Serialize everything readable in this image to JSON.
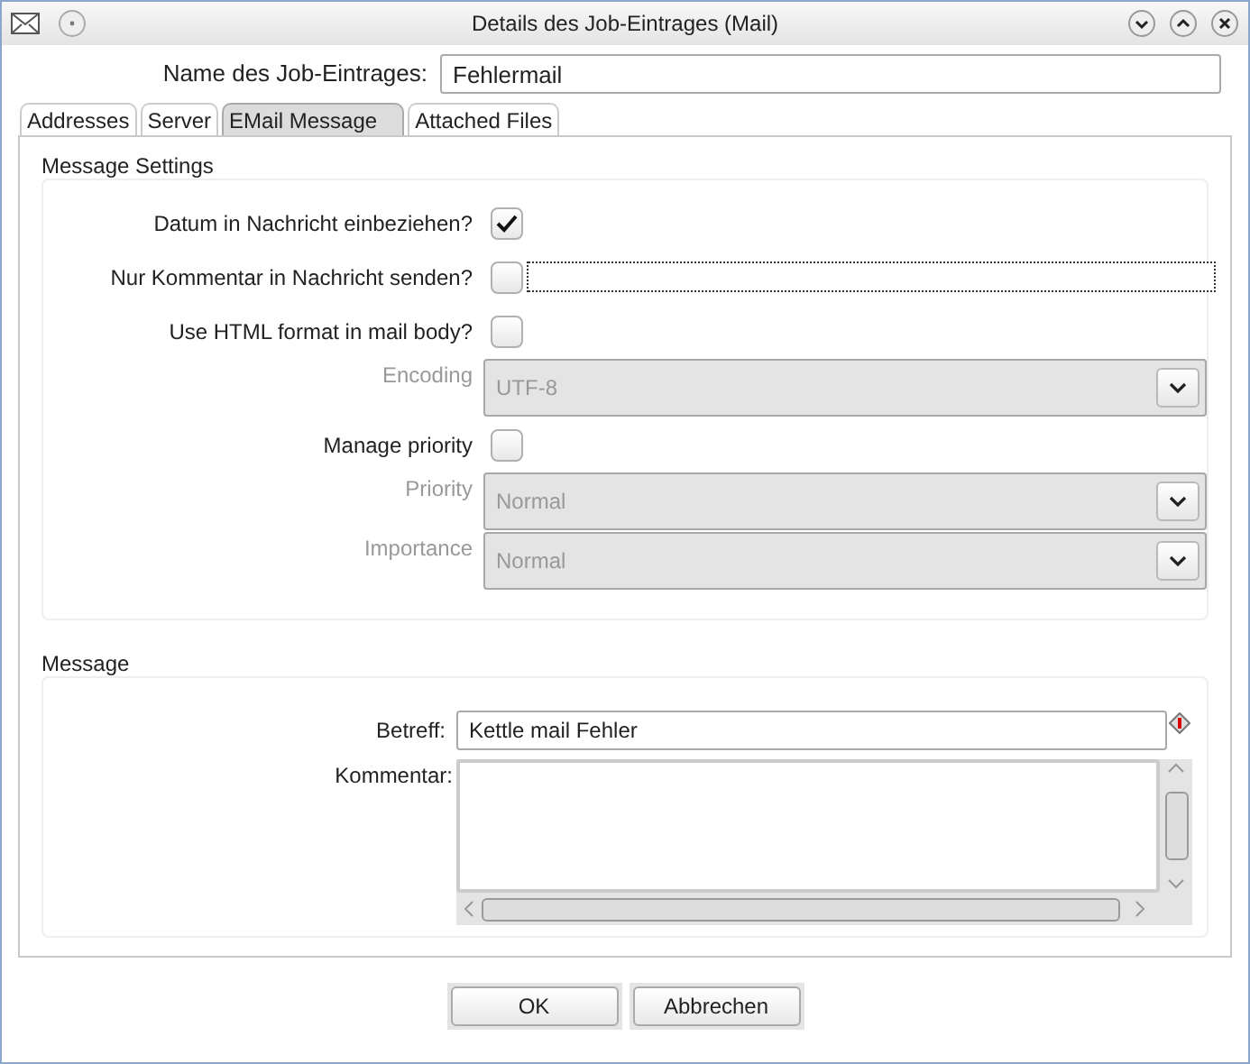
{
  "window": {
    "title": "Details des Job-Eintrages (Mail)"
  },
  "name_field": {
    "label": "Name des Job-Eintrages:",
    "value": "Fehlermail"
  },
  "tabs": [
    {
      "label": "Addresses",
      "selected": false
    },
    {
      "label": "Server",
      "selected": false
    },
    {
      "label": "EMail Message",
      "selected": true
    },
    {
      "label": "Attached Files",
      "selected": false
    }
  ],
  "message_settings": {
    "title": "Message Settings",
    "rows": [
      {
        "kind": "checkbox",
        "label": "Datum in Nachricht einbeziehen?",
        "checked": true,
        "disabled": false
      },
      {
        "kind": "checkbox_field",
        "label": "Nur Kommentar in Nachricht senden?",
        "checked": false,
        "disabled": false
      },
      {
        "kind": "checkbox",
        "label": "Use HTML format in mail body?",
        "checked": false,
        "disabled": false
      },
      {
        "kind": "select",
        "label": "Encoding",
        "value": "UTF-8",
        "disabled": true
      },
      {
        "kind": "checkbox",
        "label": "Manage priority",
        "checked": false,
        "disabled": false
      },
      {
        "kind": "select",
        "label": "Priority",
        "value": "Normal",
        "disabled": true
      },
      {
        "kind": "select",
        "label": "Importance",
        "value": "Normal",
        "disabled": true
      }
    ]
  },
  "message": {
    "title": "Message",
    "subject_label": "Betreff:",
    "subject_value": "Kettle mail Fehler",
    "comment_label": "Kommentar:"
  },
  "buttons": [
    "OK",
    "Abbrechen"
  ]
}
